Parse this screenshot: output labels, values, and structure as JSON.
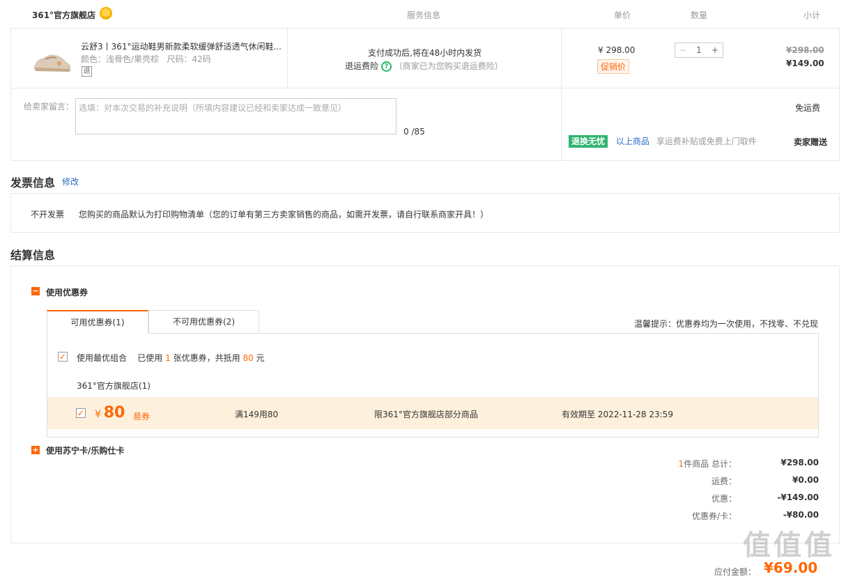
{
  "header": {
    "store_name": "361°官方旗舰店",
    "col_service": "服务信息",
    "col_price": "单价",
    "col_qty": "数量",
    "col_subtotal": "小计"
  },
  "product": {
    "title": "云舒3丨361°运动鞋男新款柔软缓弹舒适透气休闲鞋...",
    "color_label": "颜色：",
    "color_value": "浅骨色/果壳棕",
    "size_label": "尺码：",
    "size_value": "42码",
    "return_tag": "退",
    "service_line1": "支付成功后,将在48小时内发货",
    "service_insurance": "退运费险",
    "service_insurance_note": "（商家已为您购买退运费险）",
    "unit_price": "¥ 298.00",
    "promo_tag": "促销价",
    "quantity": "1",
    "qty_minus": "−",
    "qty_plus": "+",
    "original_subtotal": "¥298.00",
    "subtotal": "¥149.00"
  },
  "message": {
    "label": "给卖家留言：",
    "placeholder": "选填：对本次交易的补充说明（所填内容建议已经和卖家达成一致意见）",
    "counter": "0 /85",
    "shipping": "免运费",
    "worry_free_tag": "退换无忧",
    "worry_free_scope": "以上商品",
    "worry_free_desc": "享运费补贴或免费上门取件",
    "seller_gift": "卖家赠送"
  },
  "invoice": {
    "title": "发票信息",
    "edit_link": "修改",
    "type": "不开发票",
    "desc": "您购买的商品默认为打印购物清单（您的订单有第三方卖家销售的商品，如需开发票，请自行联系商家开具！）"
  },
  "settlement": {
    "title": "结算信息",
    "coupon_section": "使用优惠券",
    "tabs": [
      {
        "label": "可用优惠券(1)"
      },
      {
        "label": "不可用优惠券(2)"
      }
    ],
    "tip": "温馨提示：优惠券均为一次使用，不找零、不兑现",
    "best_combo_label": "使用最优组合",
    "used_prefix": "已使用",
    "used_count": "1",
    "used_mid": "张优惠券，共抵用",
    "used_amount": "80",
    "used_suffix": "元",
    "coupon_store": "361°官方旗舰店(1)",
    "coupon": {
      "currency": "¥",
      "amount": "80",
      "type": "易券",
      "condition": "满149用80",
      "scope": "限361°官方旗舰店部分商品",
      "validity": "有效期至 2022-11-28 23:59"
    },
    "card_section": "使用苏宁卡/乐购仕卡"
  },
  "summary": {
    "count": "1",
    "count_label": "件商品 总计：",
    "total": "¥298.00",
    "shipping_label": "运费：",
    "shipping": "¥0.00",
    "discount_label": "优惠：",
    "discount": "-¥149.00",
    "coupon_label": "优惠券/卡：",
    "coupon": "-¥80.00",
    "payable_label": "应付金额：",
    "payable": "¥69.00"
  },
  "watermark": "值值值"
}
